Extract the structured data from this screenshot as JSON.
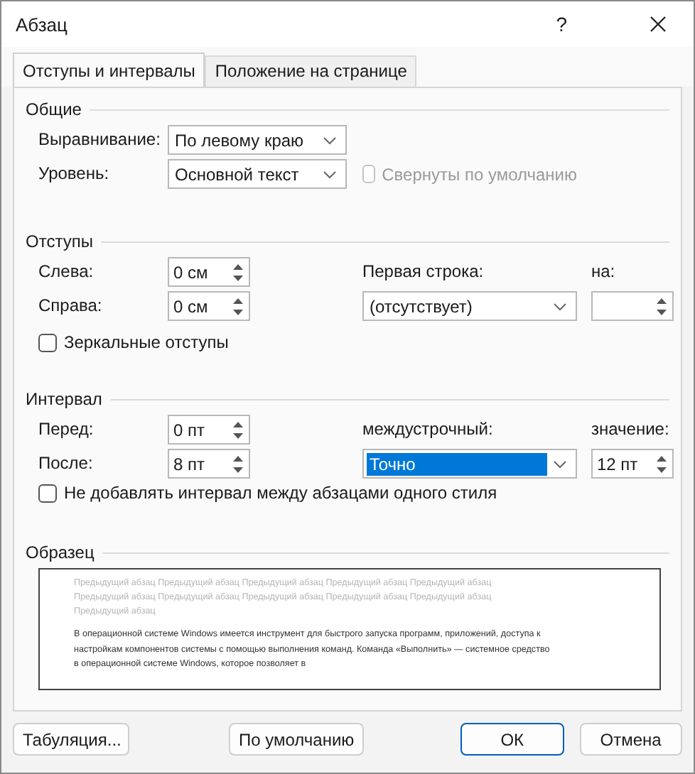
{
  "window": {
    "title": "Абзац",
    "help": "?"
  },
  "tabs": [
    {
      "label": "Отступы и интервалы",
      "selected": true
    },
    {
      "label": "Положение на странице",
      "selected": false
    }
  ],
  "general": {
    "heading": "Общие",
    "alignment": {
      "label": "Выравнивание:",
      "value": "По левому краю"
    },
    "level": {
      "label": "Уровень:",
      "value": "Основной текст"
    },
    "collapsed": {
      "label": "Свернуты по умолчанию",
      "checked": false,
      "disabled": true
    }
  },
  "indents": {
    "heading": "Отступы",
    "left": {
      "label": "Слева:",
      "value": "0 см"
    },
    "right": {
      "label": "Справа:",
      "value": "0 см"
    },
    "first_line": {
      "label": "Первая строка:",
      "value": "(отсутствует)"
    },
    "by": {
      "label": "на:"
    },
    "mirror": {
      "label": "Зеркальные отступы",
      "checked": false
    }
  },
  "spacing": {
    "heading": "Интервал",
    "before": {
      "label": "Перед:",
      "value": "0 пт"
    },
    "after": {
      "label": "После:",
      "value": "8 пт"
    },
    "line": {
      "label": "междустрочный:",
      "value": "Точно",
      "selected": true
    },
    "at": {
      "label": "значение:",
      "value": "12 пт"
    },
    "no_space": {
      "label": "Не добавлять интервал между абзацами одного стиля",
      "checked": false
    }
  },
  "preview": {
    "heading": "Образец",
    "previous_lines": [
      "Предыдущий абзац Предыдущий абзац Предыдущий абзац Предыдущий абзац Предыдущий абзац",
      "Предыдущий абзац Предыдущий абзац Предыдущий абзац Предыдущий абзац Предыдущий абзац",
      "Предыдущий абзац"
    ],
    "sample_lines": [
      "В операционной системе Windows имеется инструмент для быстрого запуска программ, приложений, доступа к",
      "настройкам компонентов системы с помощью выполнения команд. Команда «Выполнить» — системное средство",
      "в операционной системе Windows, которое позволяет в"
    ]
  },
  "buttons": [
    {
      "label": "Табуляция...",
      "default": false
    },
    {
      "label": "По умолчанию",
      "default": false
    },
    {
      "label": "ОК",
      "default": true
    },
    {
      "label": "Отмена",
      "default": false
    }
  ]
}
